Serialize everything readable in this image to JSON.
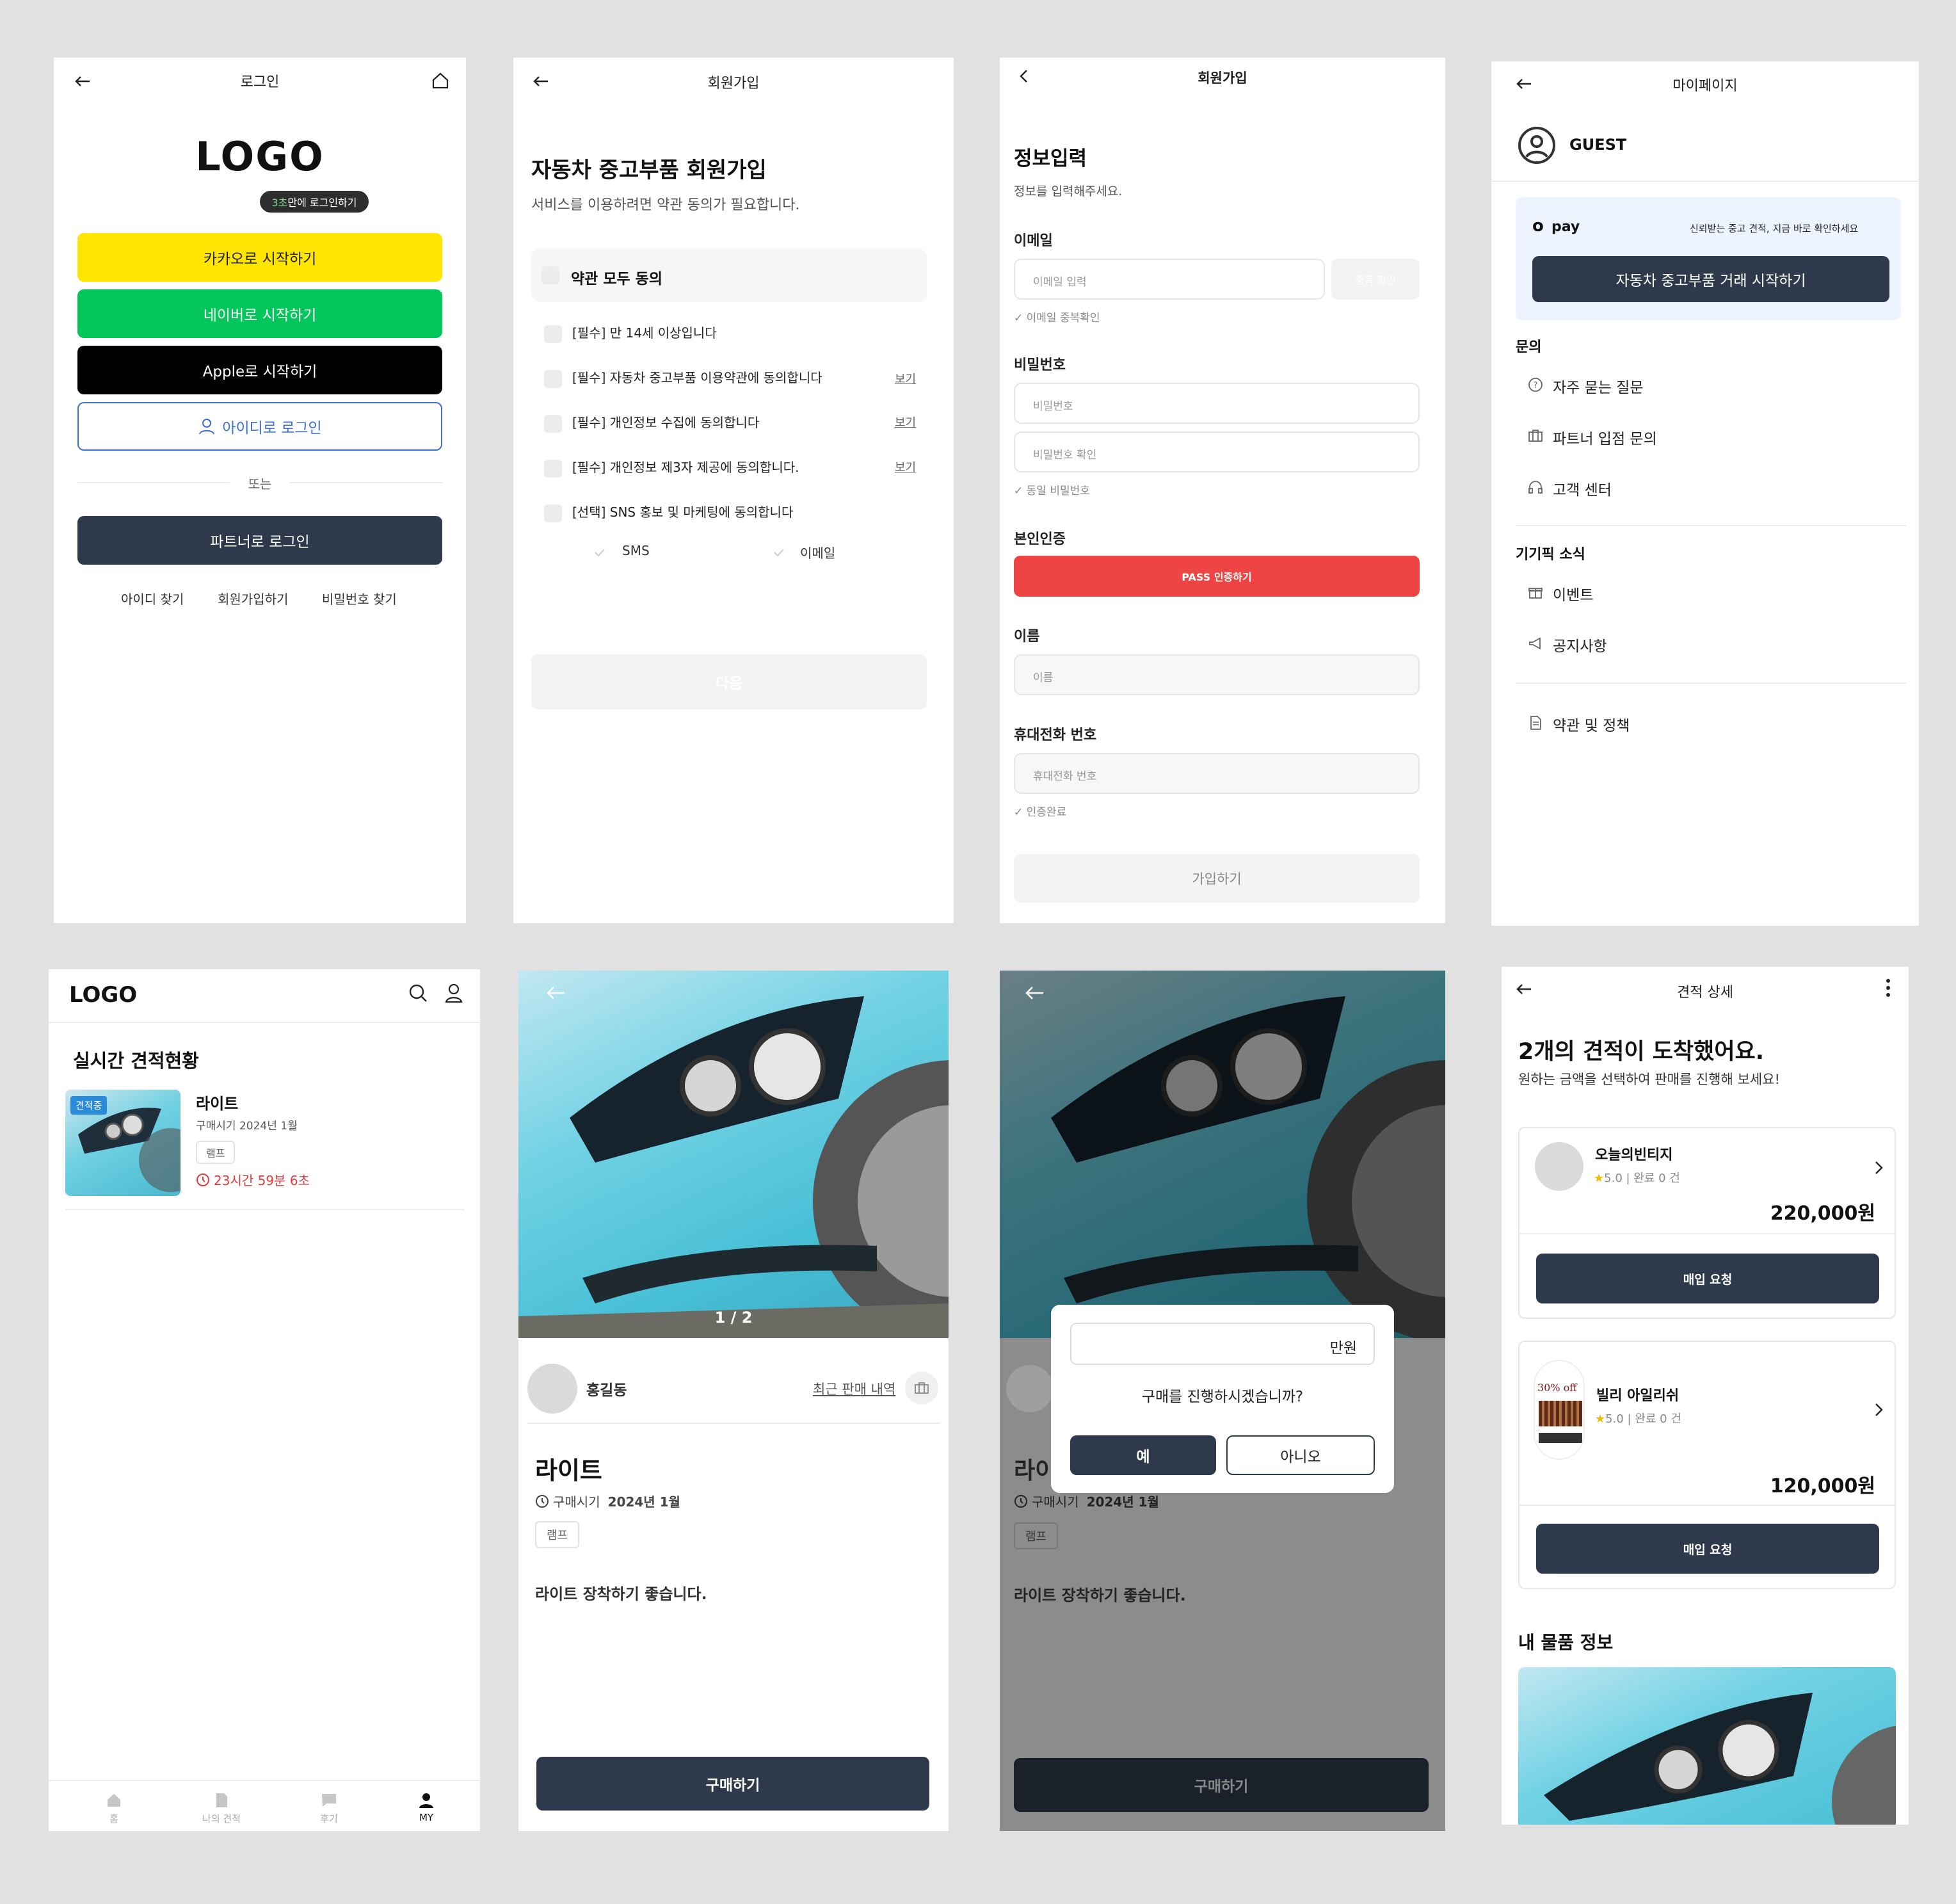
{
  "login": {
    "title": "로그인",
    "logo": "LOGO",
    "tooltip_prefix": "3초",
    "tooltip_suffix": "만에 로그인하기",
    "kakao": "카카오로 시작하기",
    "naver": "네이버로 시작하기",
    "apple": "Apple로 시작하기",
    "id_login": "아이디로 로그인",
    "or": "또는",
    "partner": "파트너로 로그인",
    "links": [
      "아이디 찾기",
      "회원가입하기",
      "비밀번호 찾기"
    ],
    "colors": {
      "kakao": "#FFE500",
      "naver": "#03C75A",
      "apple": "#000000",
      "primary": "#2E3A4B"
    }
  },
  "signup_terms": {
    "title": "회원가입",
    "heading": "자동차 중고부품 회원가입",
    "sub": "서비스를 이용하려면 약관 동의가 필요합니다.",
    "agree_all": "약관 모두 동의",
    "terms": [
      {
        "label": "[필수] 만 14세 이상입니다",
        "view": ""
      },
      {
        "label": "[필수] 자동차 중고부품 이용약관에 동의합니다",
        "view": "보기"
      },
      {
        "label": "[필수] 개인정보 수집에 동의합니다",
        "view": "보기"
      },
      {
        "label": "[필수] 개인정보 제3자 제공에 동의합니다.",
        "view": "보기"
      },
      {
        "label": "[선택] SNS 홍보 및 마케팅에 동의합니다",
        "view": ""
      }
    ],
    "sms": "SMS",
    "email": "이메일",
    "next": "다음"
  },
  "signup_info": {
    "title": "회원가입",
    "heading": "정보입력",
    "sub": "정보를 입력해주세요.",
    "email_label": "이메일",
    "email_ph": "이메일 입력",
    "dup_btn": "중복 확인",
    "email_hint": "이메일 중복확인",
    "pw_label": "비밀번호",
    "pw_ph": "비밀번호",
    "pw2_ph": "비밀번호 확인",
    "pw_hint": "동일 비밀번호",
    "auth_label": "본인인증",
    "pass_btn": "PASS 인증하기",
    "name_label": "이름",
    "name_ph": "이름",
    "phone_label": "휴대전화 번호",
    "phone_ph": "휴대전화 번호",
    "phone_hint": "인증완료",
    "submit": "가입하기",
    "pass_color": "#EE4444"
  },
  "mypage": {
    "title": "마이페이지",
    "user": "GUEST",
    "pay_logo": "o",
    "pay_word": "pay",
    "pay_desc": "신뢰받는 중고 견적, 지금 바로 확인하세요",
    "cta": "자동차 중고부품 거래 시작하기",
    "section1": "문의",
    "faq": "자주 묻는 질문",
    "partner": "파트너 입점 문의",
    "support": "고객 센터",
    "section2": "기기픽 소식",
    "event": "이벤트",
    "notice": "공지사항",
    "policy": "약관 및 정책"
  },
  "home": {
    "logo": "LOGO",
    "heading": "실시간 견적현황",
    "badge": "견적중",
    "item_name": "라이트",
    "item_date": "구매시기 2024년 1월",
    "tag": "램프",
    "timer": "23시간 59분 6초",
    "nav": [
      "홈",
      "나의 견적",
      "후기",
      "MY"
    ]
  },
  "detail": {
    "counter": "1 / 2",
    "seller": "홍길동",
    "recent": "최근 판매 내역",
    "name": "라이트",
    "date_label": "구매시기",
    "date_value": "2024년 1월",
    "tag": "램프",
    "desc": "라이트 장착하기 좋습니다.",
    "buy": "구매하기"
  },
  "modal": {
    "unit": "만원",
    "question": "구매를 진행하시겠습니까?",
    "yes": "예",
    "no": "아니오",
    "name_partial": "라이",
    "date_label": "구매시기",
    "date_value": "2024년 1월",
    "tag": "램프",
    "desc": "라이트 장착하기 좋습니다.",
    "buy": "구매하기"
  },
  "quote": {
    "title": "견적 상세",
    "heading": "2개의 견적이 도착했어요.",
    "sub": "원하는 금액을 선택하여 판매를 진행해 보세요!",
    "offers": [
      {
        "shop": "오늘의빈티지",
        "rating": "5.0",
        "done": "완료 0 건",
        "price": "220,000원",
        "btn": "매입 요청"
      },
      {
        "shop": "빌리 아일리쉬",
        "rating": "5.0",
        "done": "완료 0 건",
        "price": "120,000원",
        "btn": "매입 요청",
        "thumb_text": "30% off"
      }
    ],
    "section": "내 물품 정보"
  }
}
